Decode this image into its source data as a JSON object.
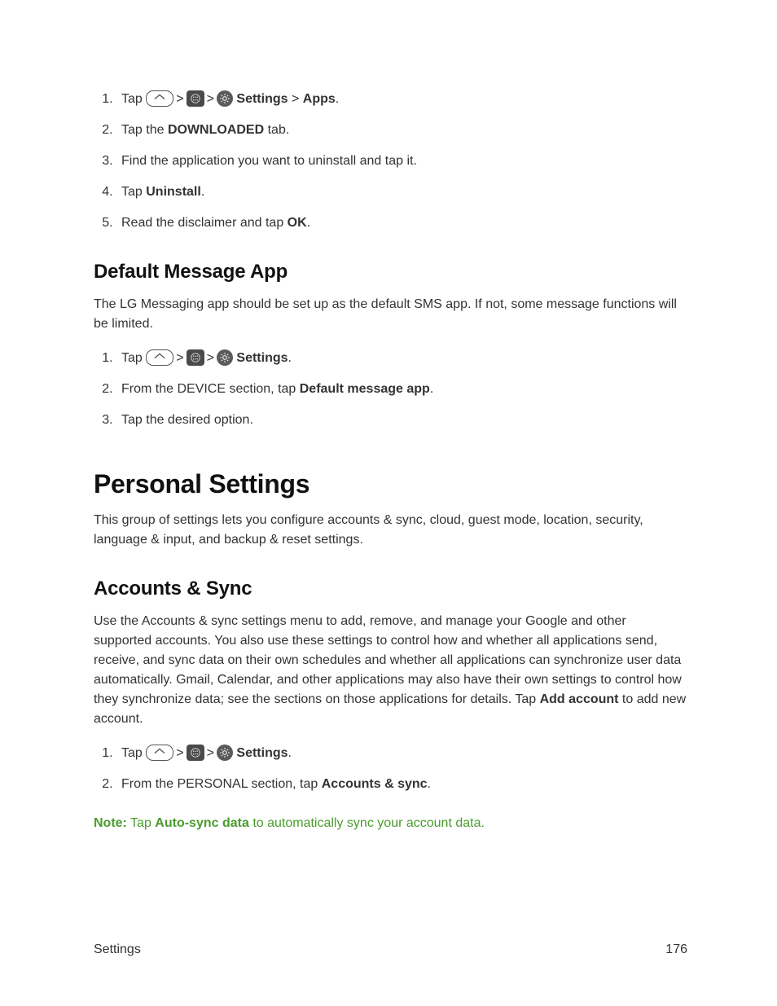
{
  "uninstall_steps": {
    "s1_prefix": "Tap ",
    "s1_sep": ">",
    "s1_settings": "Settings",
    "s1_apps": "Apps",
    "s1_period": ".",
    "s2_prefix": "Tap the ",
    "s2_bold": "DOWNLOADED",
    "s2_suffix": " tab.",
    "s3": "Find the application you want to uninstall and tap it.",
    "s4_prefix": "Tap ",
    "s4_bold": "Uninstall",
    "s4_suffix": ".",
    "s5_prefix": "Read the disclaimer and tap ",
    "s5_bold": "OK",
    "s5_suffix": "."
  },
  "default_message": {
    "heading": "Default Message App",
    "intro": "The LG Messaging app should be set up as the default SMS app. If not, some message functions will be limited.",
    "s1_prefix": "Tap ",
    "s1_sep": ">",
    "s1_settings": "Settings",
    "s1_period": ".",
    "s2_prefix": "From the DEVICE section, tap ",
    "s2_bold": "Default message app",
    "s2_suffix": ".",
    "s3": "Tap the desired option."
  },
  "personal": {
    "heading": "Personal Settings",
    "intro": "This group of settings lets you configure accounts & sync, cloud, guest mode, location, security, language & input, and backup & reset settings."
  },
  "accounts": {
    "heading": "Accounts & Sync",
    "intro_prefix": "Use the Accounts & sync settings menu to add, remove, and manage your Google and other supported accounts. You also use these settings to control how and whether all applications send, receive, and sync data on their own schedules and whether all applications can synchronize user data automatically. Gmail, Calendar, and other applications may also have their own settings to control how they synchronize data; see the sections on those applications for details. Tap ",
    "intro_bold": "Add account",
    "intro_suffix": " to add new account.",
    "s1_prefix": "Tap ",
    "s1_sep": ">",
    "s1_settings": "Settings",
    "s1_period": ".",
    "s2_prefix": "From the PERSONAL section, tap ",
    "s2_bold": "Accounts & sync",
    "s2_suffix": ".",
    "note_label": "Note:",
    "note_prefix": " Tap ",
    "note_bold": "Auto-sync data",
    "note_suffix": " to automatically sync your account data."
  },
  "footer": {
    "section": "Settings",
    "page": "176"
  }
}
